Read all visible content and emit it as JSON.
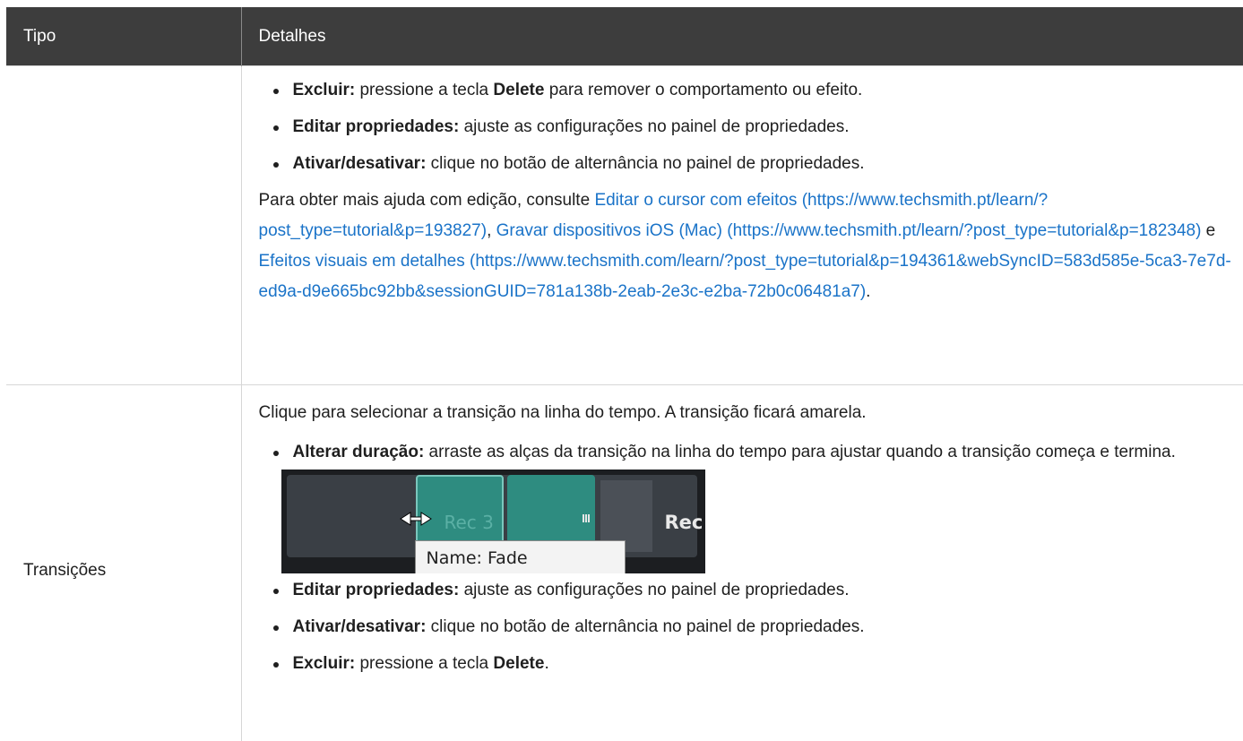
{
  "header": {
    "col_type": "Tipo",
    "col_details": "Detalhes"
  },
  "row1": {
    "type": "",
    "bullets": [
      {
        "term": "Excluir:",
        "text_a": " pressione a tecla ",
        "key": "Delete",
        "text_b": " para remover o comportamento ou efeito."
      },
      {
        "term": "Editar propriedades:",
        "text": " ajuste as configurações no painel de propriedades."
      },
      {
        "term": "Ativar/desativar:",
        "text": " clique no botão de alternância no painel de propriedades."
      }
    ],
    "help_intro": "Para obter mais ajuda com edição, consulte ",
    "link1_text": "Editar o cursor com efeitos (https://www.techsmith.pt/learn/?post_type=tutorial&p=193827)",
    "sep1": ", ",
    "link2_text": "Gravar dispositivos iOS (Mac) (https://www.techsmith.pt/learn/?post_type=tutorial&p=182348)",
    "sep2": " e ",
    "link3_text": "Efeitos visuais em detalhes (https://www.techsmith.com/learn/?post_type=tutorial&p=194361&webSyncID=583d585e-5ca3-7e7d-ed9a-d9e665bc92bb&sessionGUID=781a138b-2eab-2e3c-e2ba-72b0c06481a7)",
    "end": "."
  },
  "row2": {
    "type": "Transições",
    "intro": "Clique para selecionar a transição na linha do tempo. A transição ficará amarela.",
    "bullet_duration": {
      "term": "Alterar duração:",
      "text": " arraste as alças da transição na linha do tempo para ajustar quando a transição começa e termina."
    },
    "timeline": {
      "clip_label": "Rec 3",
      "next_label": "Rec",
      "tooltip": "Name: Fade",
      "resize_icon": "horizontal-resize-cursor-icon"
    },
    "bullets": [
      {
        "term": "Editar propriedades:",
        "text": " ajuste as configurações no painel de propriedades."
      },
      {
        "term": "Ativar/desativar:",
        "text": " clique no botão de alternância no painel de propriedades."
      },
      {
        "term": "Excluir:",
        "text_a": " pressione a tecla ",
        "key": "Delete",
        "text_b": "."
      }
    ]
  },
  "colors": {
    "header_bg": "#3d3d3d",
    "link": "#1a73c8",
    "border": "#d6d6d6"
  }
}
